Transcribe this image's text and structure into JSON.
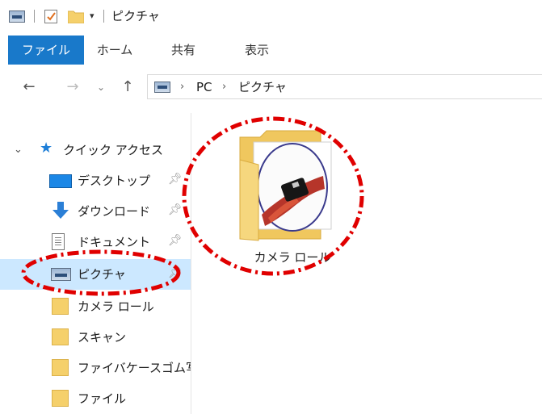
{
  "titlebar": {
    "title": "ピクチャ",
    "dropdown_glyph": "▾"
  },
  "ribbon": {
    "tabs": [
      {
        "label": "ファイル",
        "selected": true
      },
      {
        "label": "ホーム"
      },
      {
        "label": "共有"
      },
      {
        "label": "表示"
      }
    ]
  },
  "nav": {
    "back_glyph": "←",
    "forward_glyph": "→",
    "recent_glyph": "⌄",
    "up_glyph": "↑"
  },
  "address": {
    "crumbs": [
      "PC",
      "ピクチャ"
    ],
    "separator": "›"
  },
  "sidebar": {
    "quick_access_label": "クイック アクセス",
    "items": [
      {
        "label": "デスクトップ",
        "icon": "desktop-icon",
        "pinned": true
      },
      {
        "label": "ダウンロード",
        "icon": "download-icon",
        "pinned": true
      },
      {
        "label": "ドキュメント",
        "icon": "document-icon",
        "pinned": true
      },
      {
        "label": "ピクチャ",
        "icon": "pictures-icon",
        "pinned": true,
        "selected": true
      },
      {
        "label": "カメラ ロール",
        "icon": "folder-icon"
      },
      {
        "label": "スキャン",
        "icon": "folder-icon"
      },
      {
        "label": "ファイバケースゴム写",
        "icon": "folder-icon"
      },
      {
        "label": "ファイル",
        "icon": "folder-icon"
      }
    ]
  },
  "main": {
    "folders": [
      {
        "label": "カメラ ロール",
        "icon": "folder-with-photo-icon"
      }
    ]
  },
  "colors": {
    "accent": "#1979ca",
    "selected_bg": "#cce8ff",
    "highlight": "#e00000",
    "folder": "#f5d06b"
  }
}
